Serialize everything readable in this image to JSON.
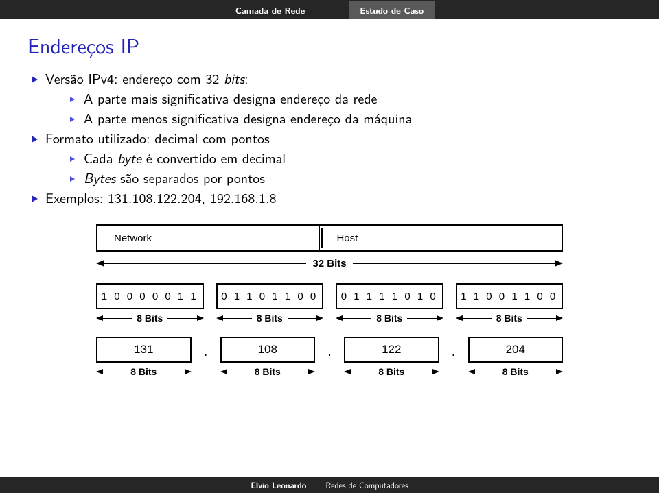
{
  "header": {
    "section1": "Camada de Rede",
    "section2": "Estudo de Caso"
  },
  "title": "Endereços IP",
  "bullets": {
    "lvl1a_pre": "Versão IPv4: endereço com 32 ",
    "lvl1a_it": "bits",
    "lvl1a_post": ":",
    "lvl2a": "A parte mais significativa designa endereço da rede",
    "lvl2b": "A parte menos significativa designa endereço da máquina",
    "lvl1b": "Formato utilizado: decimal com pontos",
    "lvl2c_pre": "Cada ",
    "lvl2c_it": "byte",
    "lvl2c_post": " é convertido em decimal",
    "lvl2d_it": "Bytes",
    "lvl2d_post": " são separados por pontos",
    "lvl1c": "Exemplos: 131.108.122.204, 192.168.1.8"
  },
  "diagram": {
    "network": "Network",
    "host": "Host",
    "bits32": "32 Bits",
    "bits8": "8 Bits",
    "bytes": [
      "1 0 0 0 0 0 1 1",
      "0 1 1 0 1 1 0 0",
      "0 1 1 1 1 0 1 0",
      "1 1 0 0 1 1 0 0"
    ],
    "decimals": [
      "131",
      "108",
      "122",
      "204"
    ],
    "dot": "."
  },
  "footer": {
    "left": "Elvio Leonardo",
    "right": "Redes de Computadores"
  }
}
